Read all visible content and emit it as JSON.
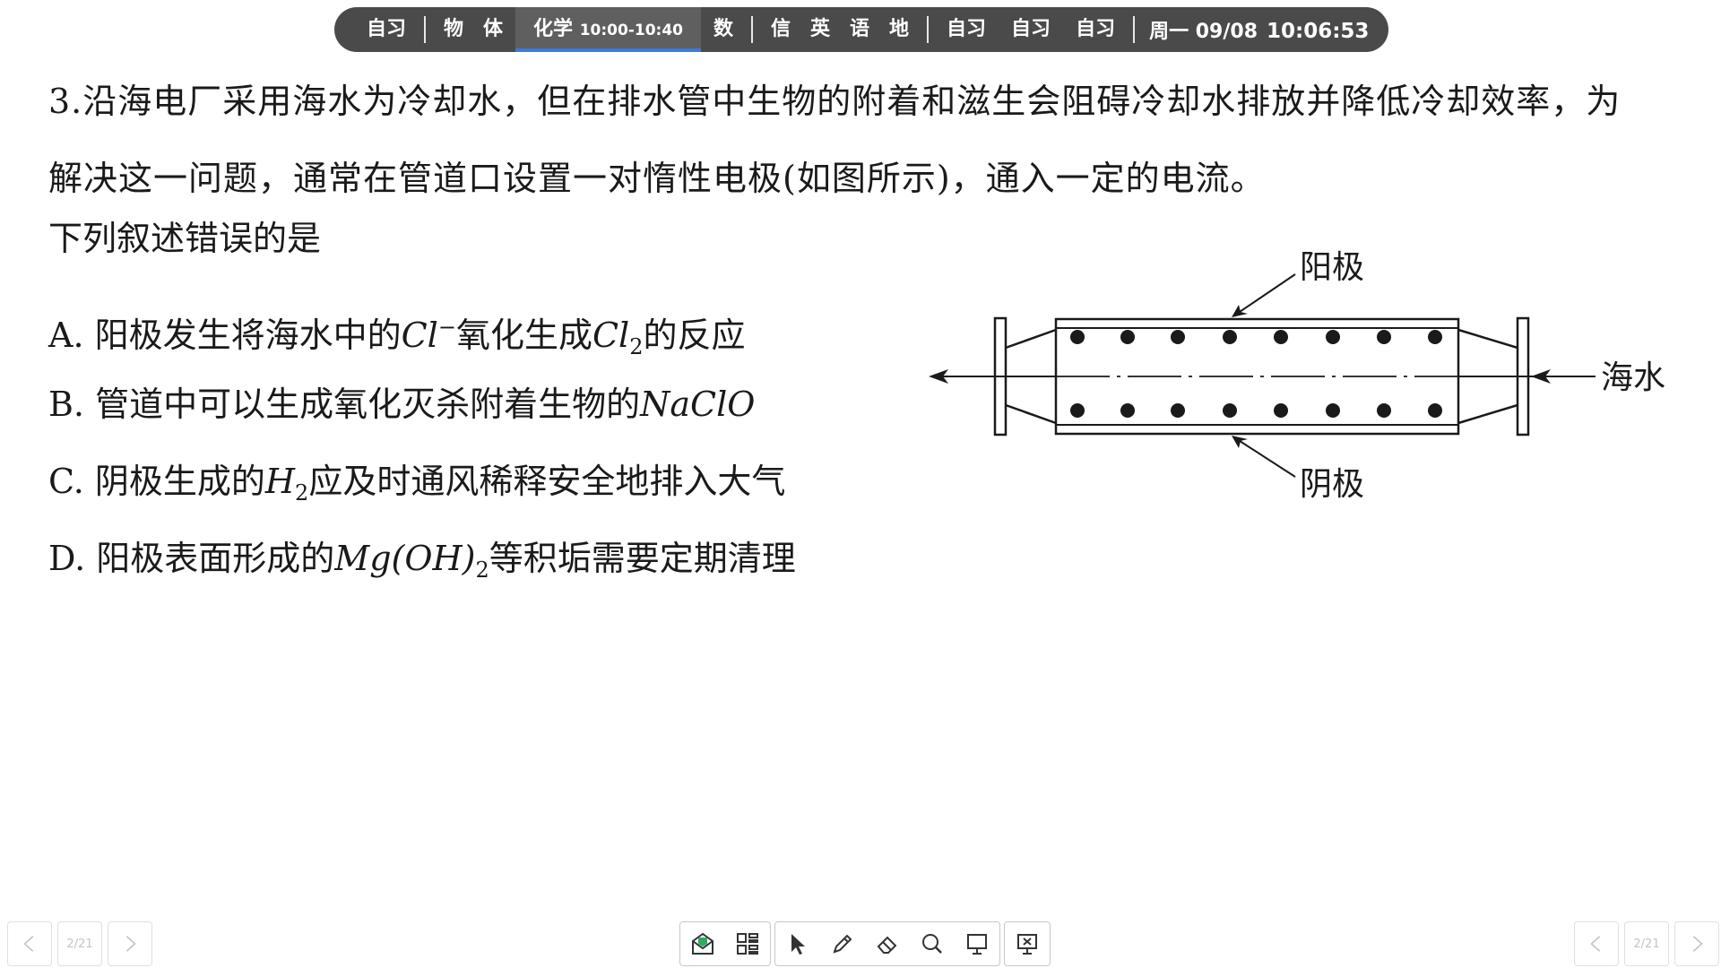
{
  "schedule": {
    "slot1": "自习",
    "slot2": "物　体",
    "active_subject": "化学",
    "active_time": "10:00-10:40",
    "slot4": "数",
    "slot5": "信　英　语　地",
    "slot6": "自习",
    "slot7": "自习",
    "slot8": "自习",
    "weekday_date": "周一 09/08",
    "clock": "10:06:53"
  },
  "question": {
    "number": "3.",
    "line1": "沿海电厂采用海水为冷却水，但在排水管中生物的附着和滋生会阻碍冷却水排放并降低冷却效率，为",
    "line2": "解决这一问题，通常在管道口设置一对惰性电极(如图所示)，通入一定的电流。",
    "prompt": "下列叙述错误的是",
    "options": {
      "A_prefix": "A. 阳极发生将海水中的",
      "A_m1": "Cl",
      "A_m1_sup": "−",
      "A_mid": "氧化生成",
      "A_m2": "Cl",
      "A_m2_sub": "2",
      "A_suffix": "的反应",
      "B_prefix": "B. 管道中可以生成氧化灭杀附着生物的",
      "B_m1": "NaClO",
      "C_prefix": "C. 阴极生成的",
      "C_m1": "H",
      "C_m1_sub": "2",
      "C_suffix": "应及时通风稀释安全地排入大气",
      "D_prefix": "D. 阳极表面形成的",
      "D_m1": "Mg(OH)",
      "D_m1_sub": "2",
      "D_suffix": "等积垢需要定期清理"
    }
  },
  "diagram": {
    "anode_label": "阳极",
    "cathode_label": "阴极",
    "seawater_label": "海水"
  },
  "pager": {
    "left_page": "2/21",
    "right_page": "2/21"
  }
}
